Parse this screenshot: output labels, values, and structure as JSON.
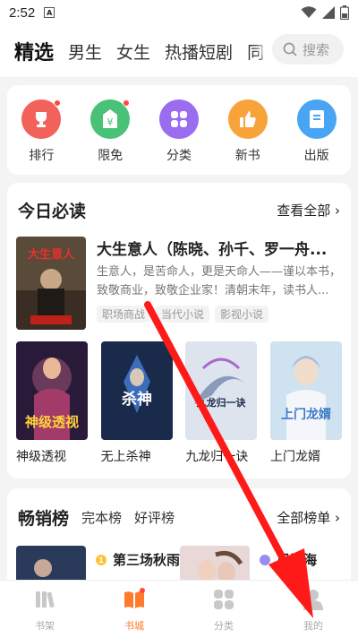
{
  "status": {
    "time": "2:52",
    "notif": "A"
  },
  "nav": {
    "tabs": [
      "精选",
      "男生",
      "女生",
      "热播短剧",
      "同"
    ],
    "search_placeholder": "搜索"
  },
  "categories": [
    {
      "label": "排行",
      "color": "#f0625a",
      "icon": "trophy-icon"
    },
    {
      "label": "限免",
      "color": "#49c277",
      "icon": "tag-icon"
    },
    {
      "label": "分类",
      "color": "#9a6cf0",
      "icon": "grid-icon"
    },
    {
      "label": "新书",
      "color": "#f8a23a",
      "icon": "thumbs-up-icon"
    },
    {
      "label": "出版",
      "color": "#4aa4f4",
      "icon": "book-icon"
    }
  ],
  "today": {
    "title": "今日必读",
    "see_all": "查看全部 ›",
    "feature": {
      "title": "大生意人（陈晓、孙千、罗一舟...",
      "desc": "生意人，是苦命人，更是天命人——谨以本书，致敬商业，致敬企业家！清朝末年，读书人...",
      "tags": [
        "职场商战",
        "当代小说",
        "影视小说"
      ],
      "cover_text": "大生意人"
    },
    "books": [
      {
        "name": "神级透视",
        "cover_text": "神级透视"
      },
      {
        "name": "无上杀神",
        "cover_text": "杀神"
      },
      {
        "name": "九龙归一诀",
        "cover_text": "九龙归一诀"
      },
      {
        "name": "上门龙婿",
        "cover_text": "上门龙婿"
      }
    ]
  },
  "bestseller": {
    "title": "畅销榜",
    "tabs": [
      "完本榜",
      "好评榜"
    ],
    "see_all": "全部榜单 ›",
    "items": [
      {
        "title": "第三场秋雨"
      },
      {
        "title": "尽江海"
      }
    ]
  },
  "tabbar": [
    {
      "label": "书架",
      "icon": "bookshelf-icon"
    },
    {
      "label": "书城",
      "icon": "bookstore-icon"
    },
    {
      "label": "分类",
      "icon": "category-icon"
    },
    {
      "label": "我的",
      "icon": "profile-icon"
    }
  ],
  "colors": {
    "accent": "#ff7a2a",
    "arrow": "#ff1a1a"
  }
}
